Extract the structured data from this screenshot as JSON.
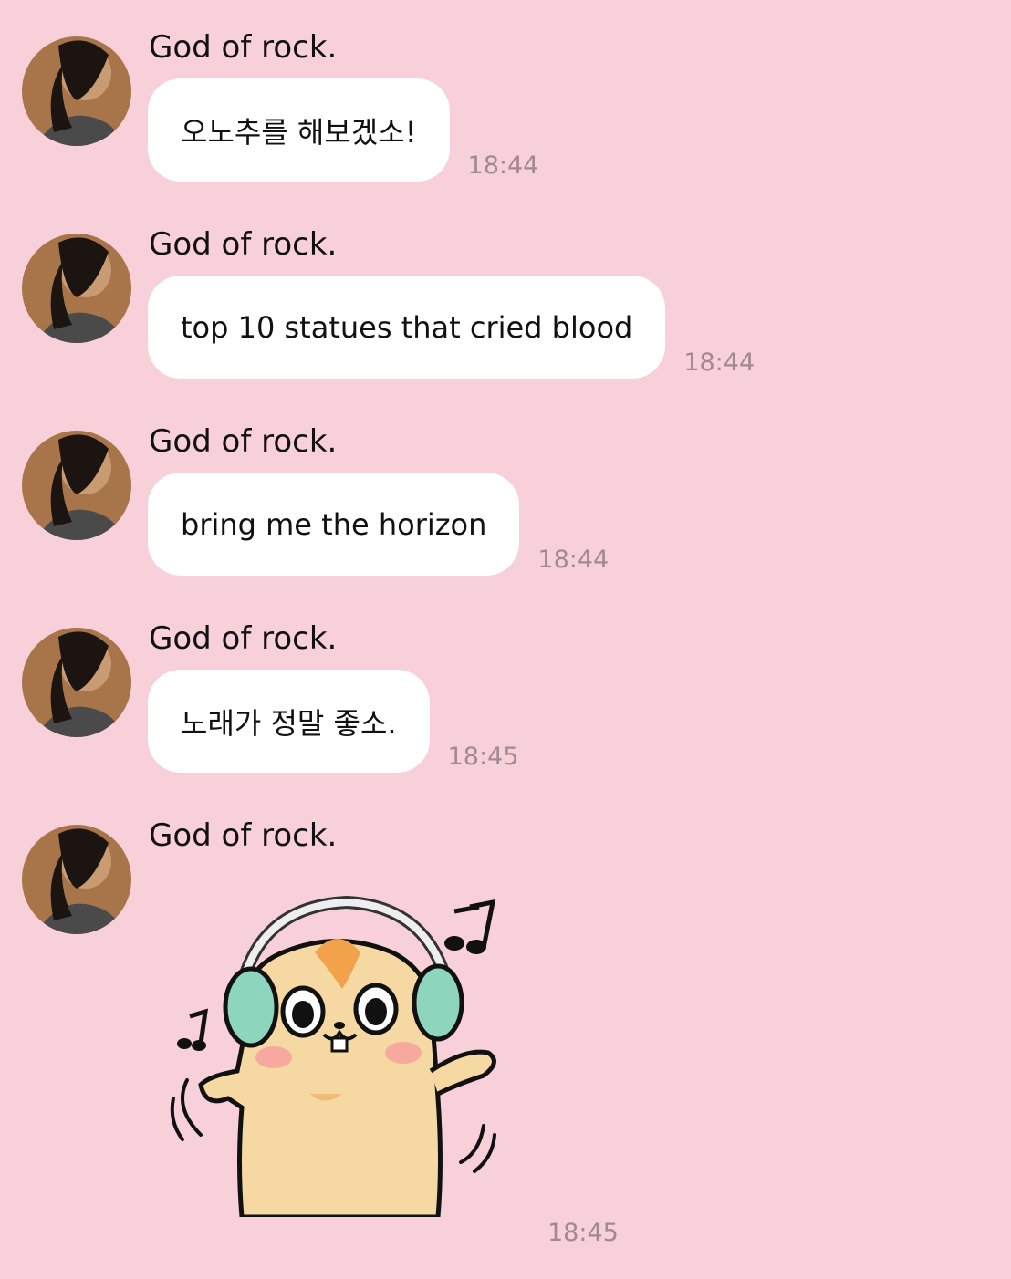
{
  "chat": {
    "messages": [
      {
        "sender": "God of rock.",
        "text": "오노추를 해보겠소!",
        "time": "18:44"
      },
      {
        "sender": "God of rock.",
        "text": "top 10 statues that cried blood",
        "time": "18:44"
      },
      {
        "sender": "God of rock.",
        "text": "bring me the horizon",
        "time": "18:44"
      },
      {
        "sender": "God of rock.",
        "text": "노래가 정말 좋소.",
        "time": "18:45"
      },
      {
        "sender": "God of rock.",
        "sticker": "hamster-with-headphones-sticker",
        "time": "18:45"
      }
    ]
  },
  "colors": {
    "background": "#F8D0DA",
    "bubble": "#FFFFFF",
    "timestamp": "#A08A90"
  }
}
